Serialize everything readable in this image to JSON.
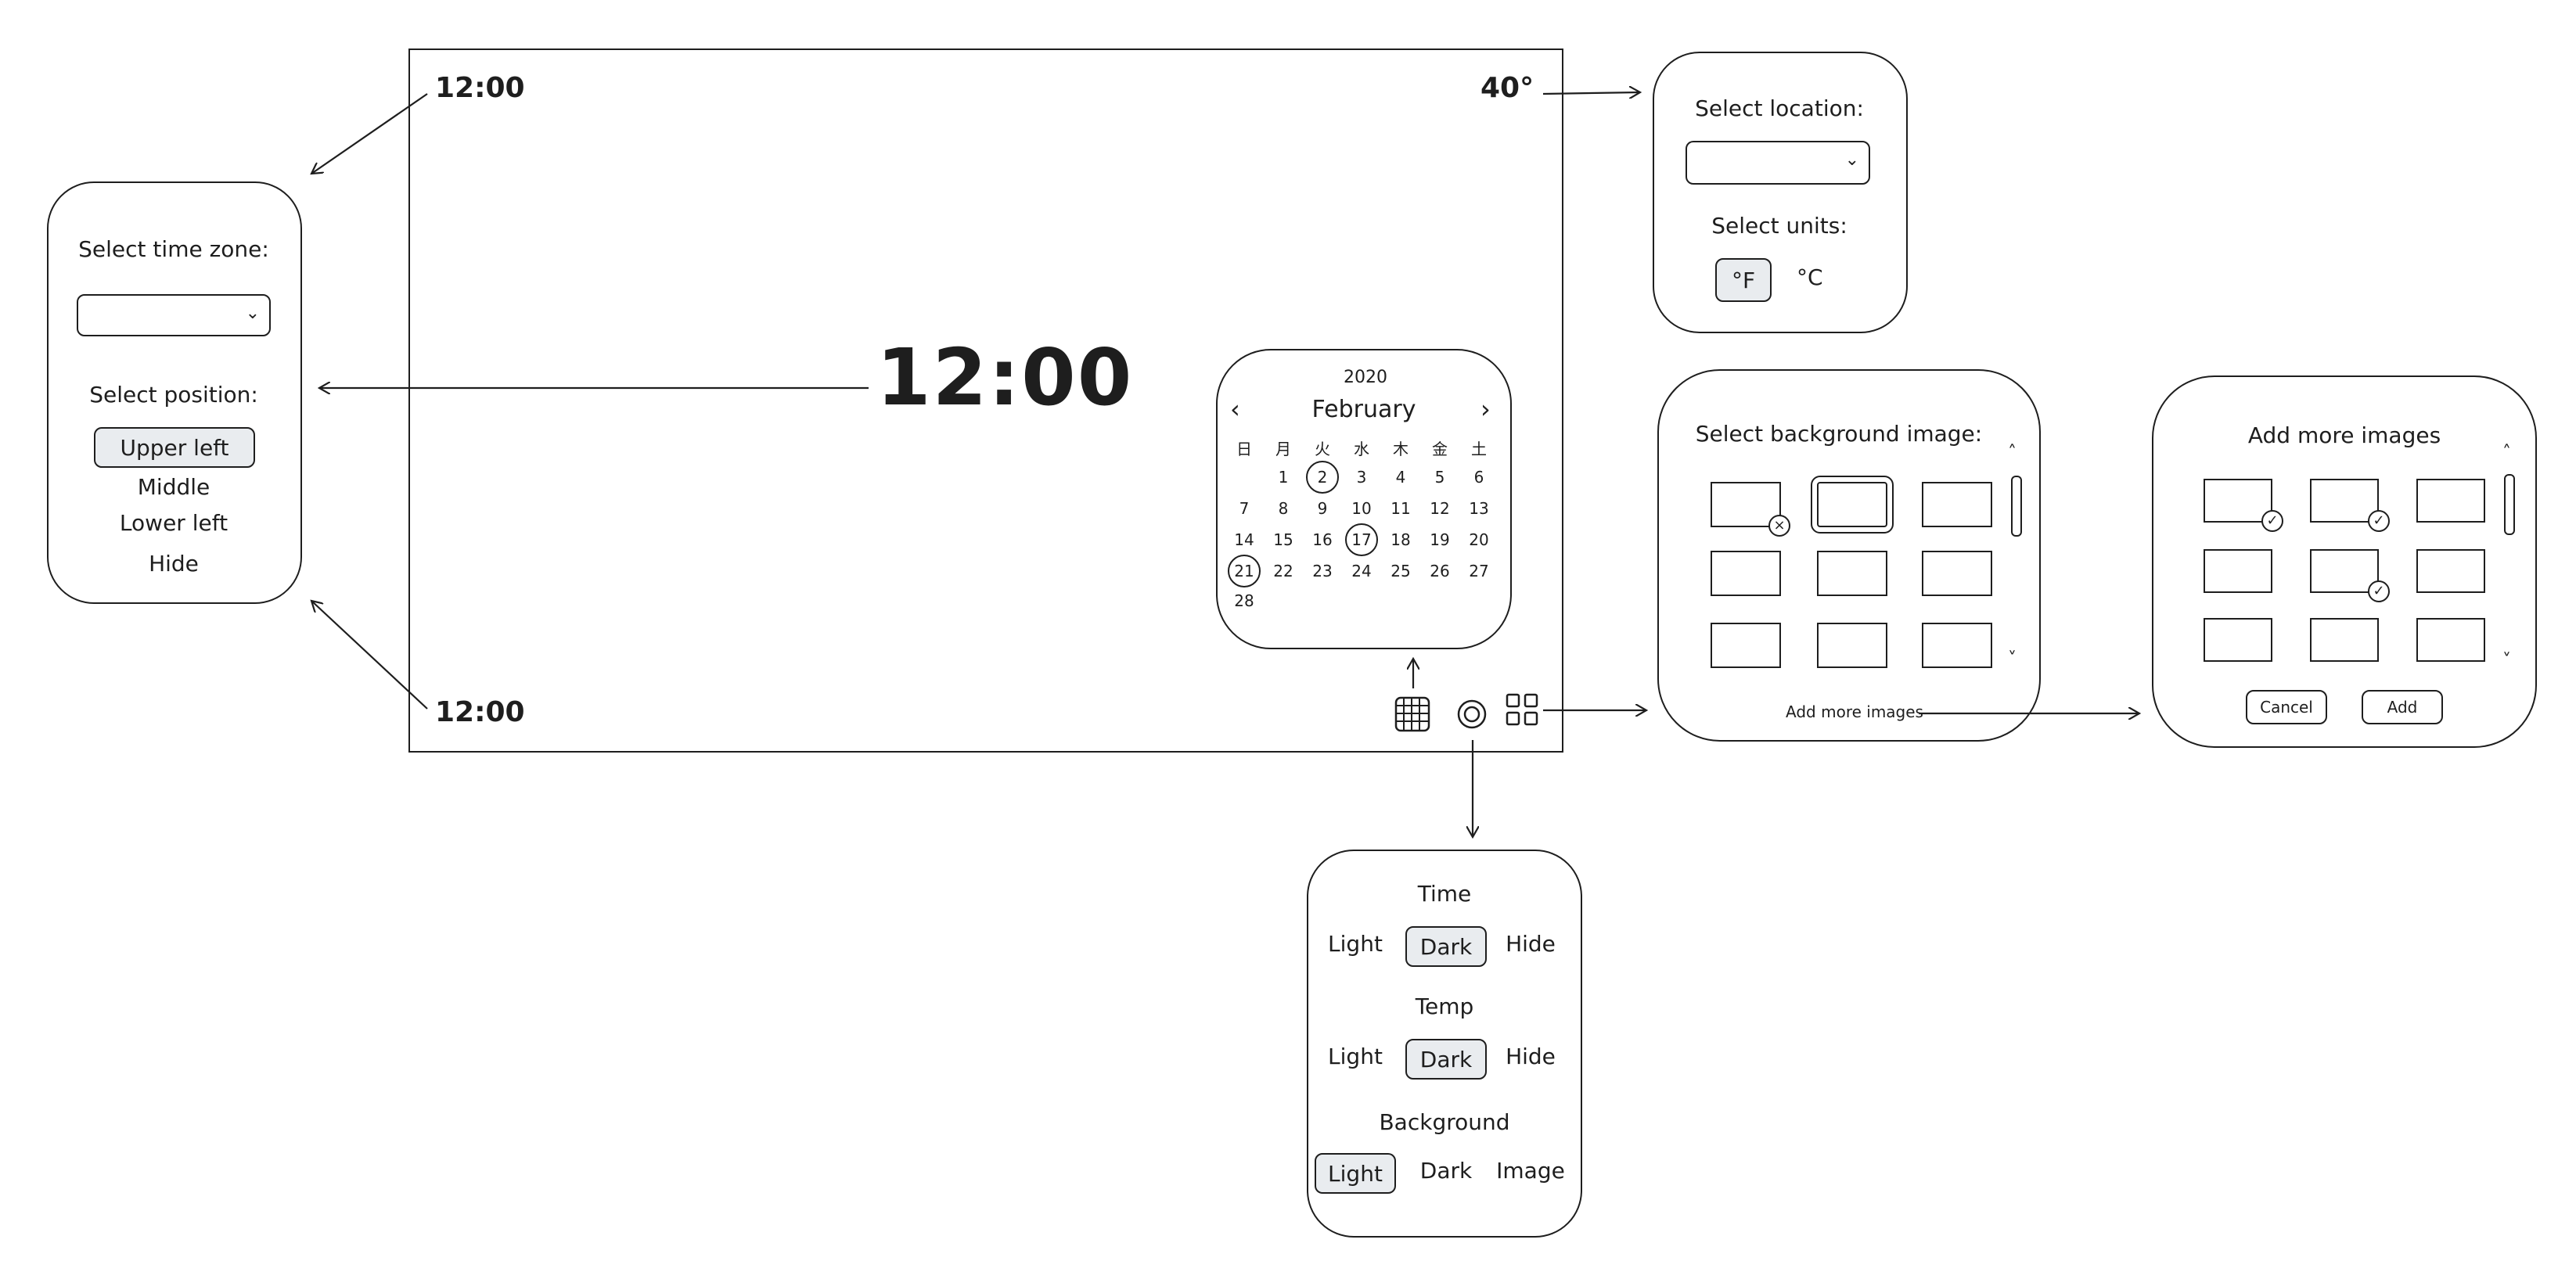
{
  "main": {
    "clock_upper_left": "12:00",
    "clock_lower_left": "12:00",
    "clock_center": "12:00",
    "temperature": "40°"
  },
  "calendar": {
    "year": "2020",
    "month": "February",
    "prev_icon": "chevron-left",
    "next_icon": "chevron-right",
    "weekdays": [
      "日",
      "月",
      "火",
      "水",
      "木",
      "金",
      "土"
    ],
    "weeks": [
      [
        "",
        "",
        "1",
        "2",
        "3",
        "4",
        "5",
        "6"
      ],
      [
        "7",
        "8",
        "9",
        "10",
        "11",
        "12",
        "13"
      ],
      [
        "14",
        "15",
        "16",
        "17",
        "18",
        "19",
        "20"
      ],
      [
        "21",
        "22",
        "23",
        "24",
        "25",
        "26",
        "27"
      ],
      [
        "28"
      ]
    ],
    "circled_days": [
      "2",
      "17",
      "21"
    ]
  },
  "toolbar": {
    "icons": [
      "calendar-grid-icon",
      "theme-ring-icon",
      "gallery-grid-icon"
    ]
  },
  "timezone_panel": {
    "title": "Select time zone:",
    "position_title": "Select position:",
    "options": [
      "Upper left",
      "Middle",
      "Lower left",
      "Hide"
    ],
    "selected": "Upper left"
  },
  "location_panel": {
    "title": "Select location:",
    "units_title": "Select units:",
    "units": [
      "°F",
      "°C"
    ],
    "selected_unit": "°F"
  },
  "background_panel": {
    "title": "Select background image:",
    "link": "Add more images"
  },
  "add_images_panel": {
    "title": "Add more images",
    "cancel": "Cancel",
    "add": "Add"
  },
  "theme_panel": {
    "sections": [
      {
        "title": "Time",
        "options": [
          "Light",
          "Dark",
          "Hide"
        ],
        "selected": "Dark"
      },
      {
        "title": "Temp",
        "options": [
          "Light",
          "Dark",
          "Hide"
        ],
        "selected": "Dark"
      },
      {
        "title": "Background",
        "options": [
          "Light",
          "Dark",
          "Image"
        ],
        "selected": "Light"
      }
    ]
  }
}
